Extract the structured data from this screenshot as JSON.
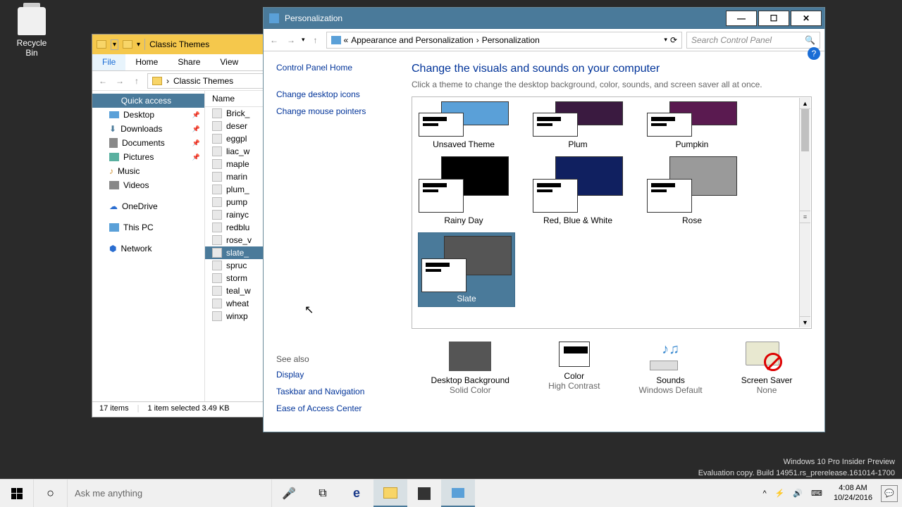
{
  "desktop": {
    "recycle_bin": "Recycle Bin",
    "watermark_line1": "Windows 10 Pro Insider Preview",
    "watermark_line2": "Evaluation copy. Build 14951.rs_prerelease.161014-1700"
  },
  "explorer": {
    "title": "Classic Themes",
    "tabs": {
      "file": "File",
      "home": "Home",
      "share": "Share",
      "view": "View"
    },
    "breadcrumb": "Classic Themes",
    "column_name": "Name",
    "sidebar": {
      "quick_access": "Quick access",
      "desktop": "Desktop",
      "downloads": "Downloads",
      "documents": "Documents",
      "pictures": "Pictures",
      "music": "Music",
      "videos": "Videos",
      "onedrive": "OneDrive",
      "this_pc": "This PC",
      "network": "Network"
    },
    "files": [
      "Brick_",
      "deser",
      "eggpl",
      "liac_w",
      "maple",
      "marin",
      "plum_",
      "pump",
      "rainyc",
      "redblu",
      "rose_v",
      "slate_",
      "spruc",
      "storm",
      "teal_w",
      "wheat",
      "winxp"
    ],
    "selected_file": "slate_",
    "status": {
      "count": "17 items",
      "selected": "1 item selected  3.49 KB"
    }
  },
  "pers": {
    "title": "Personalization",
    "nav": {
      "crumb_sep": "«",
      "crumb1": "Appearance and Personalization",
      "crumb2": "Personalization"
    },
    "search_placeholder": "Search Control Panel",
    "sidebar": {
      "home": "Control Panel Home",
      "icons": "Change desktop icons",
      "pointers": "Change mouse pointers",
      "see_also": "See also",
      "display": "Display",
      "taskbar": "Taskbar and Navigation",
      "ease": "Ease of Access Center"
    },
    "main": {
      "heading": "Change the visuals and sounds on your computer",
      "sub": "Click a theme to change the desktop background, color, sounds, and screen saver all at once."
    },
    "themes_row1": [
      {
        "name": "Unsaved Theme",
        "bg": "#5aa0d8"
      },
      {
        "name": "Plum",
        "bg": "#3a1a40"
      },
      {
        "name": "Pumpkin",
        "bg": "#5a1a50"
      }
    ],
    "themes_row2": [
      {
        "name": "Rainy Day",
        "bg": "#000000"
      },
      {
        "name": "Red, Blue & White",
        "bg": "#102060"
      },
      {
        "name": "Rose",
        "bg": "#9a9a9a"
      }
    ],
    "themes_row3": [
      {
        "name": "Slate",
        "bg": "#555555",
        "selected": true
      }
    ],
    "settings": {
      "bg_label": "Desktop Background",
      "bg_value": "Solid Color",
      "color_label": "Color",
      "color_value": "High Contrast",
      "sounds_label": "Sounds",
      "sounds_value": "Windows Default",
      "saver_label": "Screen Saver",
      "saver_value": "None"
    }
  },
  "taskbar": {
    "search_placeholder": "Ask me anything",
    "time": "4:08 AM",
    "date": "10/24/2016"
  }
}
